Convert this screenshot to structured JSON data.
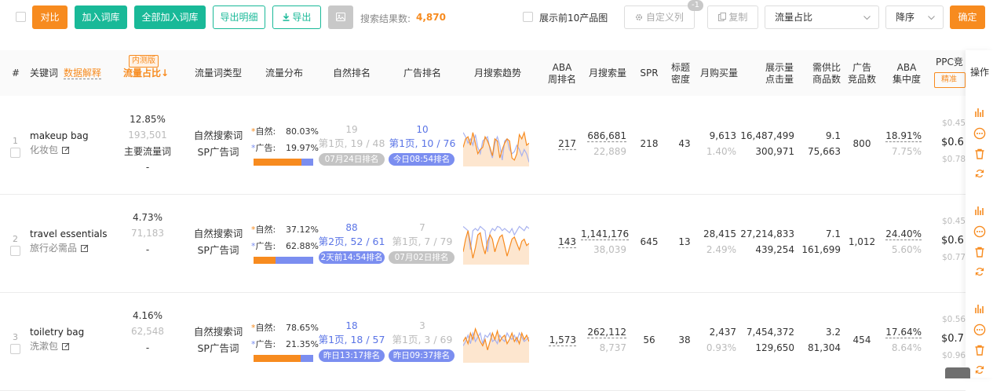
{
  "toolbar": {
    "compare": "对比",
    "add_to_lib": "加入词库",
    "add_all_to_lib": "全部加入词库",
    "export_detail": "导出明细",
    "export": "导出",
    "result_label": "搜索结果数:",
    "result_count": "4,870",
    "show_top10": "展示前10产品图",
    "custom_cols": "自定义列",
    "custom_badge": "-1",
    "copy": "复制",
    "sort_field": "流量占比",
    "sort_order": "降序",
    "confirm": "确定"
  },
  "header": {
    "index": "#",
    "keyword": "关键词",
    "data_explain": "数据解释",
    "beta_badge": "内测版",
    "traffic_share": "流量占比↓",
    "traffic_type": "流量词类型",
    "traffic_dist": "流量分布",
    "organic_rank": "自然排名",
    "ad_rank": "广告排名",
    "monthly_trend": "月搜索趋势",
    "aba_week_1": "ABA",
    "aba_week_2": "周排名",
    "monthly_search": "月搜索量",
    "spr": "SPR",
    "title_1": "标题",
    "title_2": "密度",
    "monthly_purchase": "月购买量",
    "impressions_1": "展示量",
    "impressions_2": "点击量",
    "supply_1": "需供比",
    "supply_2": "商品数",
    "ad_comp_1": "广告",
    "ad_comp_2": "竞品数",
    "aba_conc_1": "ABA",
    "aba_conc_2": "集中度",
    "ppc": "PPC竞",
    "ppc_match": "精准",
    "ops": "操作"
  },
  "labels": {
    "organic": "自然:",
    "ad": "广告:"
  },
  "rows": [
    {
      "idx": "1",
      "kw": "makeup bag",
      "kw_cn": "化妆包",
      "share": "12.85%",
      "share_num": "193,501",
      "share_main": "主要流量词",
      "share_dash": "-",
      "type1": "自然搜索词",
      "type2": "SP广告词",
      "organic_pct": "80.03%",
      "ad_pct": "19.97%",
      "organic_frac": 0.8003,
      "org_top": "19",
      "org_page": "第1页, 19 / 48",
      "org_pill": "07月24日排名",
      "org_pill_style": "gray",
      "org_active": false,
      "ad_top": "10",
      "ad_page": "第1页, 10 / 76",
      "ad_pill": "今日08:54排名",
      "ad_pill_style": "blue",
      "ad_active": true,
      "aba": "217",
      "msearch": "686,681",
      "msearch_sub": "22,889",
      "spr": "218",
      "density": "43",
      "purchase": "9,613",
      "purchase_pct": "1.40%",
      "impr": "16,487,499",
      "clicks": "300,971",
      "ratio": "9.1",
      "products": "75,663",
      "adcomp": "800",
      "conc": "18.91%",
      "conc_sub": "7.75%",
      "ppc1": "$0.45",
      "ppc2": "$0.6",
      "ppc3": "$0.78",
      "trend_orange": [
        0.55,
        0.35,
        0.3,
        0.5,
        0.2,
        0.45,
        0.7,
        0.6,
        0.55,
        0.3,
        0.4,
        0.55,
        0.75,
        0.35,
        0.4,
        0.8,
        0.6,
        0.45,
        0.35,
        0.4,
        0.8,
        0.85,
        0.7,
        0.25,
        0.35,
        0.2,
        0.5,
        0.45
      ],
      "trend_blue": [
        0.2,
        0.3,
        0.45,
        0.35,
        0.5,
        0.25,
        0.55,
        0.7,
        0.4,
        0.35,
        0.3,
        0.6,
        0.8,
        0.45,
        0.3,
        0.5,
        0.85,
        0.4,
        0.35,
        0.6,
        0.7,
        0.65,
        0.5,
        0.6,
        0.75,
        0.6,
        0.7,
        0.9
      ]
    },
    {
      "idx": "2",
      "kw": "travel essentials",
      "kw_cn": "旅行必需品",
      "share": "4.73%",
      "share_num": "71,183",
      "share_main": "",
      "share_dash": "-",
      "type1": "自然搜索词",
      "type2": "SP广告词",
      "organic_pct": "37.12%",
      "ad_pct": "62.88%",
      "organic_frac": 0.3712,
      "org_top": "88",
      "org_page": "第2页, 52 / 61",
      "org_pill": "2天前14:54排名",
      "org_pill_style": "blue",
      "org_active": true,
      "ad_top": "7",
      "ad_page": "第1页, 7 / 79",
      "ad_pill": "07月02日排名",
      "ad_pill_style": "gray",
      "ad_active": false,
      "aba": "143",
      "msearch": "1,141,176",
      "msearch_sub": "38,039",
      "spr": "645",
      "density": "13",
      "purchase": "28,415",
      "purchase_pct": "2.49%",
      "impr": "27,214,833",
      "clicks": "439,254",
      "ratio": "7.1",
      "products": "161,699",
      "adcomp": "1,012",
      "conc": "24.40%",
      "conc_sub": "5.60%",
      "ppc1": "$0.45",
      "ppc2": "$0.6",
      "ppc3": "$0.77",
      "trend_orange": [
        0.7,
        0.4,
        0.2,
        0.5,
        0.85,
        0.6,
        0.3,
        0.25,
        0.55,
        0.75,
        0.45,
        0.3,
        0.4,
        0.7,
        0.5,
        0.35,
        0.3,
        0.55,
        0.8,
        0.6,
        0.4,
        0.35,
        0.5,
        0.65,
        0.45,
        0.4,
        0.55,
        0.5
      ],
      "trend_blue": [
        0.1,
        0.15,
        0.2,
        0.65,
        0.2,
        0.15,
        0.2,
        0.1,
        0.15,
        0.2,
        0.7,
        0.25,
        0.15,
        0.2,
        0.1,
        0.12,
        0.2,
        0.15,
        0.2,
        0.25,
        0.15,
        0.3,
        0.2,
        0.1,
        0.15,
        0.2,
        0.1,
        0.15
      ]
    },
    {
      "idx": "3",
      "kw": "toiletry bag",
      "kw_cn": "洗漱包",
      "share": "4.16%",
      "share_num": "62,548",
      "share_main": "",
      "share_dash": "-",
      "type1": "自然搜索词",
      "type2": "SP广告词",
      "organic_pct": "78.65%",
      "ad_pct": "21.35%",
      "organic_frac": 0.7865,
      "org_top": "18",
      "org_page": "第1页, 18 / 57",
      "org_pill": "昨日13:17排名",
      "org_pill_style": "blue",
      "org_active": true,
      "ad_top": "3",
      "ad_page": "第1页, 3 / 69",
      "ad_pill": "昨日09:37排名",
      "ad_pill_style": "blue",
      "ad_active": false,
      "aba": "1,573",
      "msearch": "262,112",
      "msearch_sub": "8,737",
      "spr": "56",
      "density": "38",
      "purchase": "2,437",
      "purchase_pct": "0.93%",
      "impr": "7,454,372",
      "clicks": "129,650",
      "ratio": "3.2",
      "products": "81,304",
      "adcomp": "454",
      "conc": "17.64%",
      "conc_sub": "8.64%",
      "ppc1": "$0.56",
      "ppc2": "$0.7",
      "ppc3": "$0.96",
      "trend_orange": [
        0.5,
        0.4,
        0.55,
        0.3,
        0.45,
        0.2,
        0.35,
        0.5,
        0.6,
        0.45,
        0.7,
        0.5,
        0.3,
        0.45,
        0.25,
        0.5,
        0.4,
        0.35,
        0.55,
        0.45,
        0.3,
        0.5,
        0.4,
        0.55,
        0.3,
        0.45,
        0.35,
        0.5
      ],
      "trend_blue": [
        0.6,
        0.5,
        0.35,
        0.55,
        0.3,
        0.5,
        0.4,
        0.3,
        0.55,
        0.35,
        0.4,
        0.3,
        0.5,
        0.45,
        0.55,
        0.35,
        0.45,
        0.5,
        0.3,
        0.4,
        0.45,
        0.35,
        0.5,
        0.3,
        0.4,
        0.5,
        0.45,
        0.4
      ]
    }
  ],
  "colors": {
    "orange": "#f78b1f",
    "green": "#19b998",
    "blue": "#7b8ef0",
    "trend_fill": "#fde6cf",
    "delete": "#f78b1f"
  }
}
